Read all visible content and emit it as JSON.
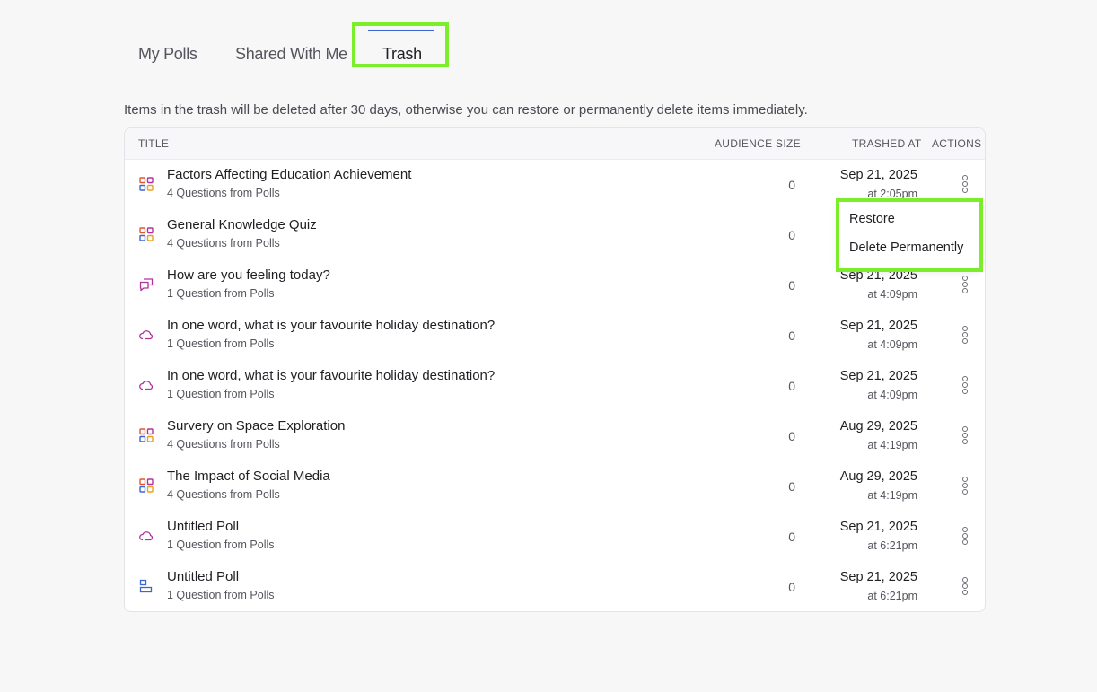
{
  "tabs": [
    {
      "label": "My Polls",
      "active": false
    },
    {
      "label": "Shared With Me",
      "active": false
    },
    {
      "label": "Trash",
      "active": true
    }
  ],
  "notice": "Items in the trash will be deleted after 30 days, otherwise you can restore or permanently delete items immediately.",
  "table": {
    "headers": {
      "title": "TITLE",
      "audience": "AUDIENCE SIZE",
      "trashed": "TRASHED AT",
      "actions": "ACTIONS"
    },
    "rows": [
      {
        "icon": "quiz-grid-icon",
        "title": "Factors Affecting Education Achievement",
        "subtitle": "4 Questions from Polls",
        "audience": "0",
        "date": "Sep 21, 2025",
        "time": "at 2:05pm"
      },
      {
        "icon": "quiz-grid-icon",
        "title": "General Knowledge Quiz",
        "subtitle": "4 Questions from Polls",
        "audience": "0",
        "date": "",
        "time": ""
      },
      {
        "icon": "chat-bubbles-icon",
        "title": "How are you feeling today?",
        "subtitle": "1 Question from Polls",
        "audience": "0",
        "date": "Sep 21, 2025",
        "time": "at 4:09pm"
      },
      {
        "icon": "word-cloud-icon",
        "title": "In one word, what is your favourite holiday destination?",
        "subtitle": "1 Question from Polls",
        "audience": "0",
        "date": "Sep 21, 2025",
        "time": "at 4:09pm"
      },
      {
        "icon": "word-cloud-icon",
        "title": "In one word, what is your favourite holiday destination?",
        "subtitle": "1 Question from Polls",
        "audience": "0",
        "date": "Sep 21, 2025",
        "time": "at 4:09pm"
      },
      {
        "icon": "quiz-grid-icon",
        "title": "Survery on Space Exploration",
        "subtitle": "4 Questions from Polls",
        "audience": "0",
        "date": "Aug 29, 2025",
        "time": "at 4:19pm"
      },
      {
        "icon": "quiz-grid-icon",
        "title": "The Impact of Social Media",
        "subtitle": "4 Questions from Polls",
        "audience": "0",
        "date": "Aug 29, 2025",
        "time": "at 4:19pm"
      },
      {
        "icon": "word-cloud-icon",
        "title": "Untitled Poll",
        "subtitle": "1 Question from Polls",
        "audience": "0",
        "date": "Sep 21, 2025",
        "time": "at 6:21pm"
      },
      {
        "icon": "bar-poll-icon",
        "title": "Untitled Poll",
        "subtitle": "1 Question from Polls",
        "audience": "0",
        "date": "Sep 21, 2025",
        "time": "at 6:21pm"
      }
    ]
  },
  "context_menu": {
    "restore": "Restore",
    "delete": "Delete Permanently"
  },
  "colors": {
    "highlight": "#7ced2a",
    "accent": "#3b64d4",
    "icon_purple": "#b0329c"
  }
}
